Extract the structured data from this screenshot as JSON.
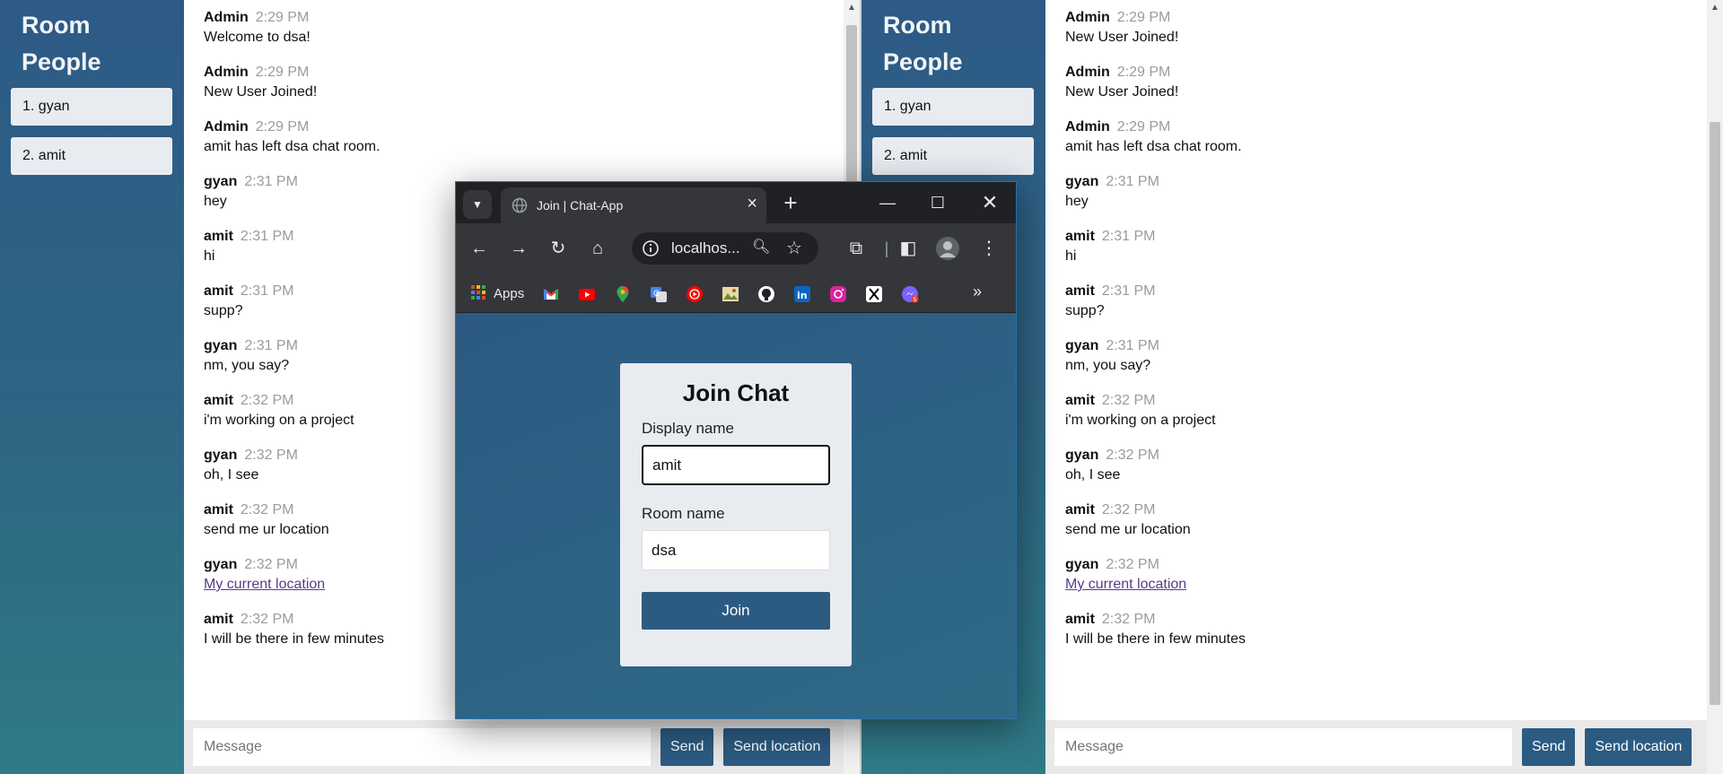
{
  "sidebar": {
    "title_line1": "Room",
    "title_line2": "People",
    "people": [
      "1. gyan",
      "2. amit"
    ]
  },
  "left_messages": [
    {
      "name": "Admin",
      "time": "2:29 PM",
      "text": "Welcome to dsa!"
    },
    {
      "name": "Admin",
      "time": "2:29 PM",
      "text": "New User Joined!"
    },
    {
      "name": "Admin",
      "time": "2:29 PM",
      "text": "amit has left dsa chat room."
    },
    {
      "name": "gyan",
      "time": "2:31 PM",
      "text": "hey"
    },
    {
      "name": "amit",
      "time": "2:31 PM",
      "text": "hi"
    },
    {
      "name": "amit",
      "time": "2:31 PM",
      "text": "supp?"
    },
    {
      "name": "gyan",
      "time": "2:31 PM",
      "text": "nm, you say?"
    },
    {
      "name": "amit",
      "time": "2:32 PM",
      "text": "i'm working on a project"
    },
    {
      "name": "gyan",
      "time": "2:32 PM",
      "text": "oh, I see"
    },
    {
      "name": "amit",
      "time": "2:32 PM",
      "text": "send me ur location"
    },
    {
      "name": "gyan",
      "time": "2:32 PM",
      "text": "My current location",
      "link": true
    },
    {
      "name": "amit",
      "time": "2:32 PM",
      "text": "I will be there in few minutes"
    }
  ],
  "right_messages": [
    {
      "name": "Admin",
      "time": "2:29 PM",
      "text": "New User Joined!"
    },
    {
      "name": "Admin",
      "time": "2:29 PM",
      "text": "New User Joined!"
    },
    {
      "name": "Admin",
      "time": "2:29 PM",
      "text": "amit has left dsa chat room."
    },
    {
      "name": "gyan",
      "time": "2:31 PM",
      "text": "hey"
    },
    {
      "name": "amit",
      "time": "2:31 PM",
      "text": "hi"
    },
    {
      "name": "amit",
      "time": "2:31 PM",
      "text": "supp?"
    },
    {
      "name": "gyan",
      "time": "2:31 PM",
      "text": "nm, you say?"
    },
    {
      "name": "amit",
      "time": "2:32 PM",
      "text": "i'm working on a project"
    },
    {
      "name": "gyan",
      "time": "2:32 PM",
      "text": "oh, I see"
    },
    {
      "name": "amit",
      "time": "2:32 PM",
      "text": "send me ur location"
    },
    {
      "name": "gyan",
      "time": "2:32 PM",
      "text": "My current location",
      "link": true
    },
    {
      "name": "amit",
      "time": "2:32 PM",
      "text": "I will be there in few minutes"
    }
  ],
  "composer": {
    "placeholder": "Message",
    "send_label": "Send",
    "send_location_label": "Send location"
  },
  "browser": {
    "tab_title": "Join | Chat-App",
    "url": "localhos...",
    "bookmarks_apps_label": "Apps",
    "bookmark_icons": [
      "gmail-icon",
      "youtube-icon",
      "maps-icon",
      "translate-icon",
      "youtube-music-icon",
      "photo-icon",
      "github-icon",
      "linkedin-icon",
      "instagram-icon",
      "x-icon",
      "messenger-icon"
    ],
    "bookmark_badge": "5"
  },
  "join": {
    "title": "Join Chat",
    "display_label": "Display name",
    "display_value": "amit",
    "room_label": "Room name",
    "room_value": "dsa",
    "button_label": "Join"
  },
  "colors": {
    "accent": "#2c5b82",
    "sidebar_top": "#2d5a86",
    "sidebar_bottom": "#2f7a86",
    "time_gray": "#9b9b9b"
  }
}
